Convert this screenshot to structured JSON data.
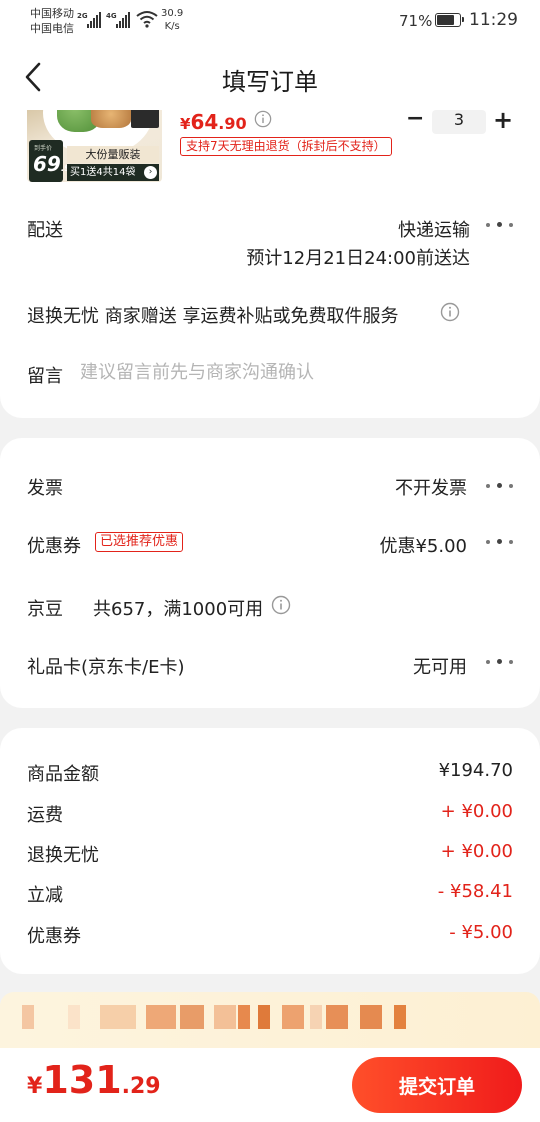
{
  "status_bar": {
    "carrier_1": "中国移动",
    "carrier_2": "中国电信",
    "network_1": "2G",
    "network_2": "4G",
    "speed_value": "30.9",
    "speed_unit": "K/s",
    "battery_percent": "71%",
    "battery_level": 0.71,
    "time": "11:29"
  },
  "header": {
    "title": "填写订单"
  },
  "product": {
    "image_price_label": "到手价",
    "image_price_int": "69",
    "image_price_dec": ".9",
    "image_promo_1": "大份量贩装",
    "image_promo_2": "买1送4共14袋",
    "price_symbol": "¥",
    "price_int": "64",
    "price_dec": ".90",
    "refund_note": "支持7天无理由退货（拆封后不支持）",
    "qty_minus": "−",
    "qty_value": "3",
    "qty_plus": "+"
  },
  "delivery": {
    "label": "配送",
    "method": "快递运输",
    "eta": "预计12月21日24:00前送达"
  },
  "service": {
    "text": "退换无忧 商家赠送 享运费补贴或免费取件服务"
  },
  "note": {
    "label": "留言",
    "placeholder": "建议留言前先与商家沟通确认"
  },
  "invoice": {
    "label": "发票",
    "value": "不开发票"
  },
  "coupon": {
    "label": "优惠券",
    "badge": "已选推荐优惠",
    "value": "优惠¥5.00"
  },
  "jingdou": {
    "label": "京豆",
    "text": "共657，满1000可用"
  },
  "giftcard": {
    "label": "礼品卡(京东卡/E卡)",
    "value": "无可用"
  },
  "summary": {
    "items": [
      {
        "label": "商品金额",
        "value": "¥194.70"
      },
      {
        "label": "运费",
        "value": "+ ¥0.00"
      },
      {
        "label": "退换无忧",
        "value": "+ ¥0.00"
      },
      {
        "label": "立减",
        "value": "- ¥58.41"
      },
      {
        "label": "优惠券",
        "value": "- ¥5.00"
      }
    ]
  },
  "bottom": {
    "total_symbol": "¥",
    "total_int": "131",
    "total_dec": ".29",
    "submit_label": "提交订单"
  },
  "colors": {
    "accent": "#e2231a",
    "background": "#f2f2f2",
    "banner": "#fdf2d8"
  }
}
